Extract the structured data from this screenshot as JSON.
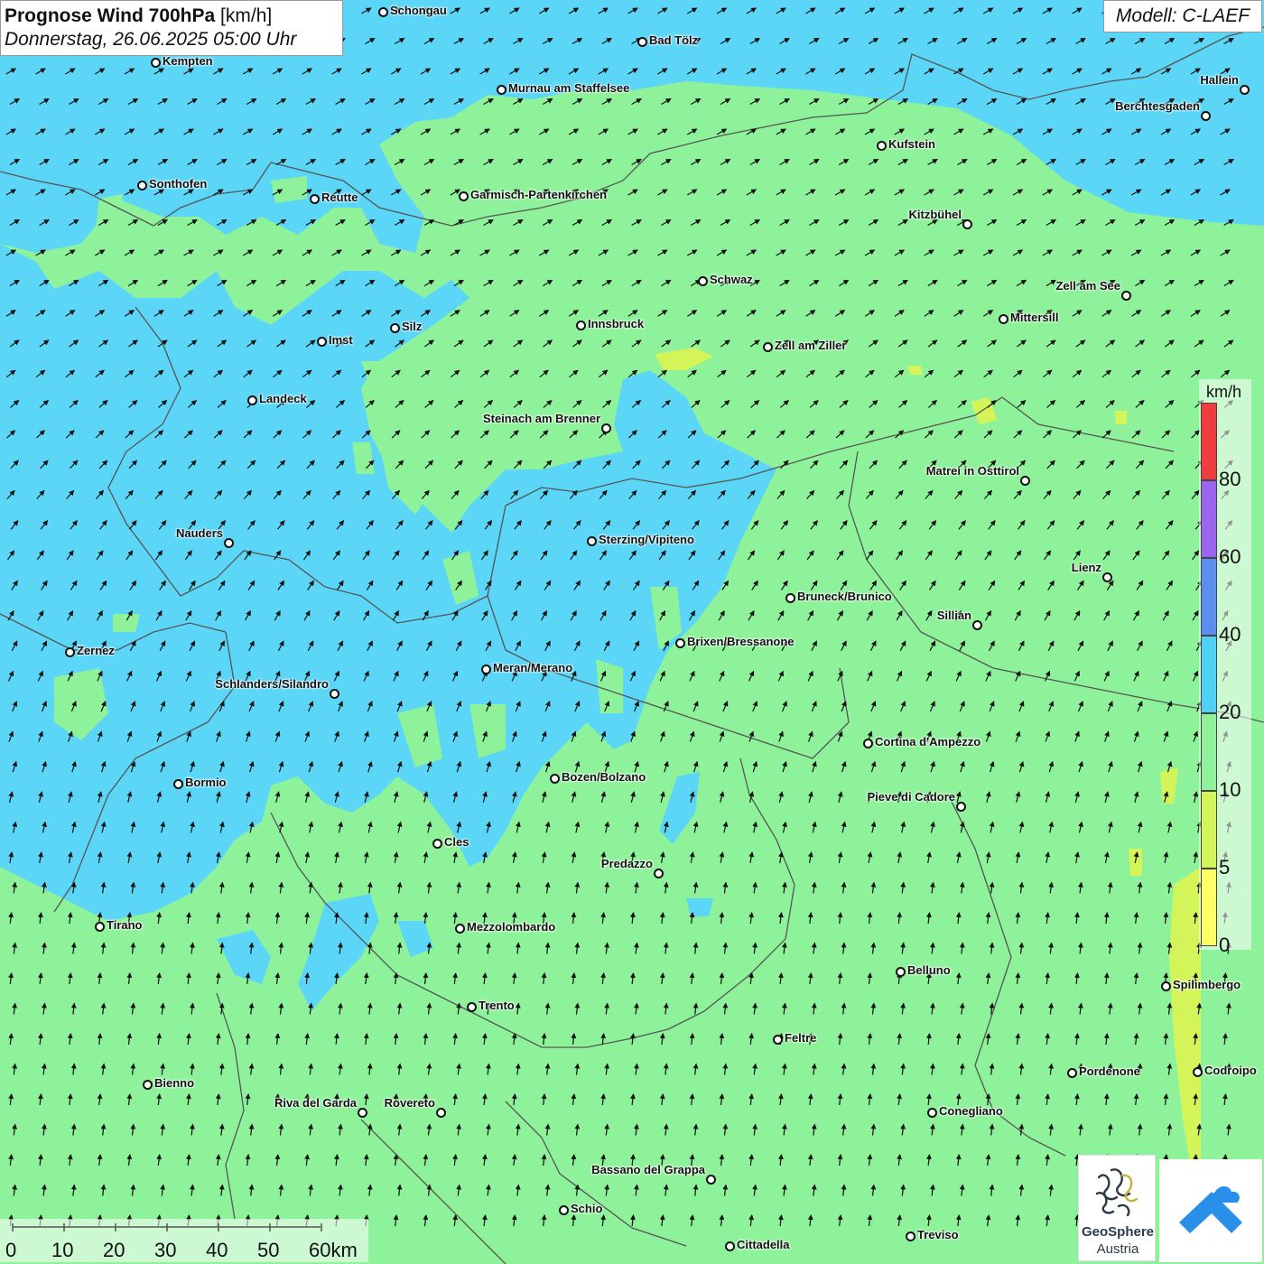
{
  "header": {
    "title_bold": "Prognose Wind 700hPa",
    "title_unit": "[km/h]",
    "date": "Donnerstag, 26.06.2025 05:00 Uhr"
  },
  "model_label": "Modell: C-LAEF",
  "legend": {
    "unit": "km/h",
    "bins": [
      {
        "label": "0",
        "color": "#ffff66"
      },
      {
        "label": "5",
        "color": "#d4f55a"
      },
      {
        "label": "10",
        "color": "#8ef29a"
      },
      {
        "label": "20",
        "color": "#4fd0f5"
      },
      {
        "label": "40",
        "color": "#5a8ff0"
      },
      {
        "label": "60",
        "color": "#9a66f0"
      },
      {
        "label": "80",
        "color": "#f03c3c"
      }
    ]
  },
  "scale_bar": {
    "labels": [
      "0",
      "10",
      "20",
      "30",
      "40",
      "50",
      "60km"
    ]
  },
  "colors": {
    "wind_10_20": "#8ef29a",
    "wind_20_40": "#5bd6f7",
    "wind_5_10": "#d4f55a",
    "wind_0_5": "#ffff66",
    "arrow": "#111111",
    "border": "#555555"
  },
  "cities": [
    {
      "name": "Schongau"
    },
    {
      "name": "Bad Tölz"
    },
    {
      "name": "Kempten"
    },
    {
      "name": "Murnau am Staffelsee"
    },
    {
      "name": "Hallein"
    },
    {
      "name": "Berchtesgaden"
    },
    {
      "name": "Kufstein"
    },
    {
      "name": "Sonthofen"
    },
    {
      "name": "Reutte"
    },
    {
      "name": "Garmisch-Partenkirchen"
    },
    {
      "name": "Kitzbühel"
    },
    {
      "name": "Schwaz"
    },
    {
      "name": "Zell am See"
    },
    {
      "name": "Mittersill"
    },
    {
      "name": "Innsbruck"
    },
    {
      "name": "Imst"
    },
    {
      "name": "Silz"
    },
    {
      "name": "Zell am Ziller"
    },
    {
      "name": "Landeck"
    },
    {
      "name": "Steinach am Brenner"
    },
    {
      "name": "Matrei in Osttirol"
    },
    {
      "name": "Nauders"
    },
    {
      "name": "Sterzing/Vipiteno"
    },
    {
      "name": "Lienz"
    },
    {
      "name": "Bruneck/Brunico"
    },
    {
      "name": "Sillian"
    },
    {
      "name": "Brixen/Bressanone"
    },
    {
      "name": "Zernez"
    },
    {
      "name": "Meran/Merano"
    },
    {
      "name": "Schlanders/Silandro"
    },
    {
      "name": "Cortina d'Ampezzo"
    },
    {
      "name": "Bozen/Bolzano"
    },
    {
      "name": "Bormio"
    },
    {
      "name": "Pieve di Cadore"
    },
    {
      "name": "Cles"
    },
    {
      "name": "Predazzo"
    },
    {
      "name": "Tirano"
    },
    {
      "name": "Mezzolombardo"
    },
    {
      "name": "Belluno"
    },
    {
      "name": "Spilimbergo"
    },
    {
      "name": "Trento"
    },
    {
      "name": "Feltre"
    },
    {
      "name": "Pordenone"
    },
    {
      "name": "Codroipo"
    },
    {
      "name": "Bienno"
    },
    {
      "name": "Riva del Garda"
    },
    {
      "name": "Rovereto"
    },
    {
      "name": "Conegliano"
    },
    {
      "name": "Bassano del Grappa"
    },
    {
      "name": "Schio"
    },
    {
      "name": "Treviso"
    },
    {
      "name": "Cittadella"
    }
  ],
  "logos": {
    "geosphere_name": "GeoSphere",
    "geosphere_sub": "Austria"
  }
}
